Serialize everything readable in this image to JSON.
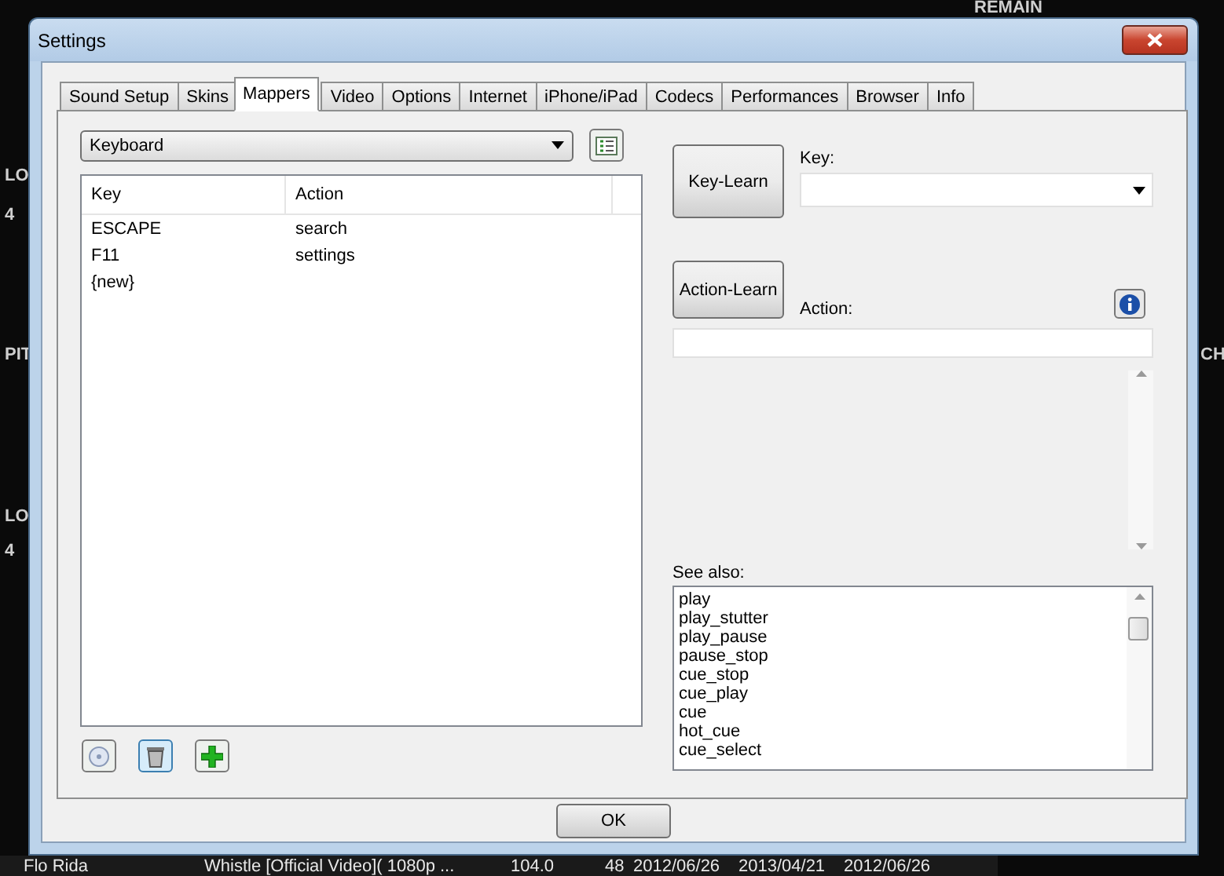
{
  "background_app": {
    "top_labels": [
      "REMAIN"
    ],
    "left_labels": [
      "LO",
      "4",
      "PIT",
      "LO",
      "4"
    ],
    "right_labels": [
      "CH"
    ],
    "track_row": [
      "Flo Rida",
      "Whistle [Official Video]( 1080p ...",
      "104.0",
      "48",
      "2012/06/26",
      "2013/04/21",
      "2012/06/26"
    ]
  },
  "window": {
    "title": "Settings"
  },
  "tabs": [
    {
      "label": "Sound Setup",
      "selected": false
    },
    {
      "label": "Skins",
      "selected": false
    },
    {
      "label": "Mappers",
      "selected": true
    },
    {
      "label": "Video",
      "selected": false
    },
    {
      "label": "Options",
      "selected": false
    },
    {
      "label": "Internet",
      "selected": false
    },
    {
      "label": "iPhone/iPad",
      "selected": false
    },
    {
      "label": "Codecs",
      "selected": false
    },
    {
      "label": "Performances",
      "selected": false
    },
    {
      "label": "Browser",
      "selected": false
    },
    {
      "label": "Info",
      "selected": false
    }
  ],
  "mapper_select": {
    "value": "Keyboard"
  },
  "mappings": {
    "columns": [
      "Key",
      "Action"
    ],
    "rows": [
      [
        "ESCAPE",
        "search"
      ],
      [
        "F11",
        "settings"
      ],
      [
        "{new}"
      ]
    ]
  },
  "key_learn_button": "Key-Learn",
  "key_label": "Key:",
  "action_learn_button": "Action-Learn",
  "action_label": "Action:",
  "see_also": {
    "label": "See also:",
    "items": [
      "play",
      "play_stutter",
      "play_pause",
      "pause_stop",
      "cue_stop",
      "cue_play",
      "cue",
      "hot_cue",
      "cue_select"
    ]
  },
  "ok_button": "OK"
}
